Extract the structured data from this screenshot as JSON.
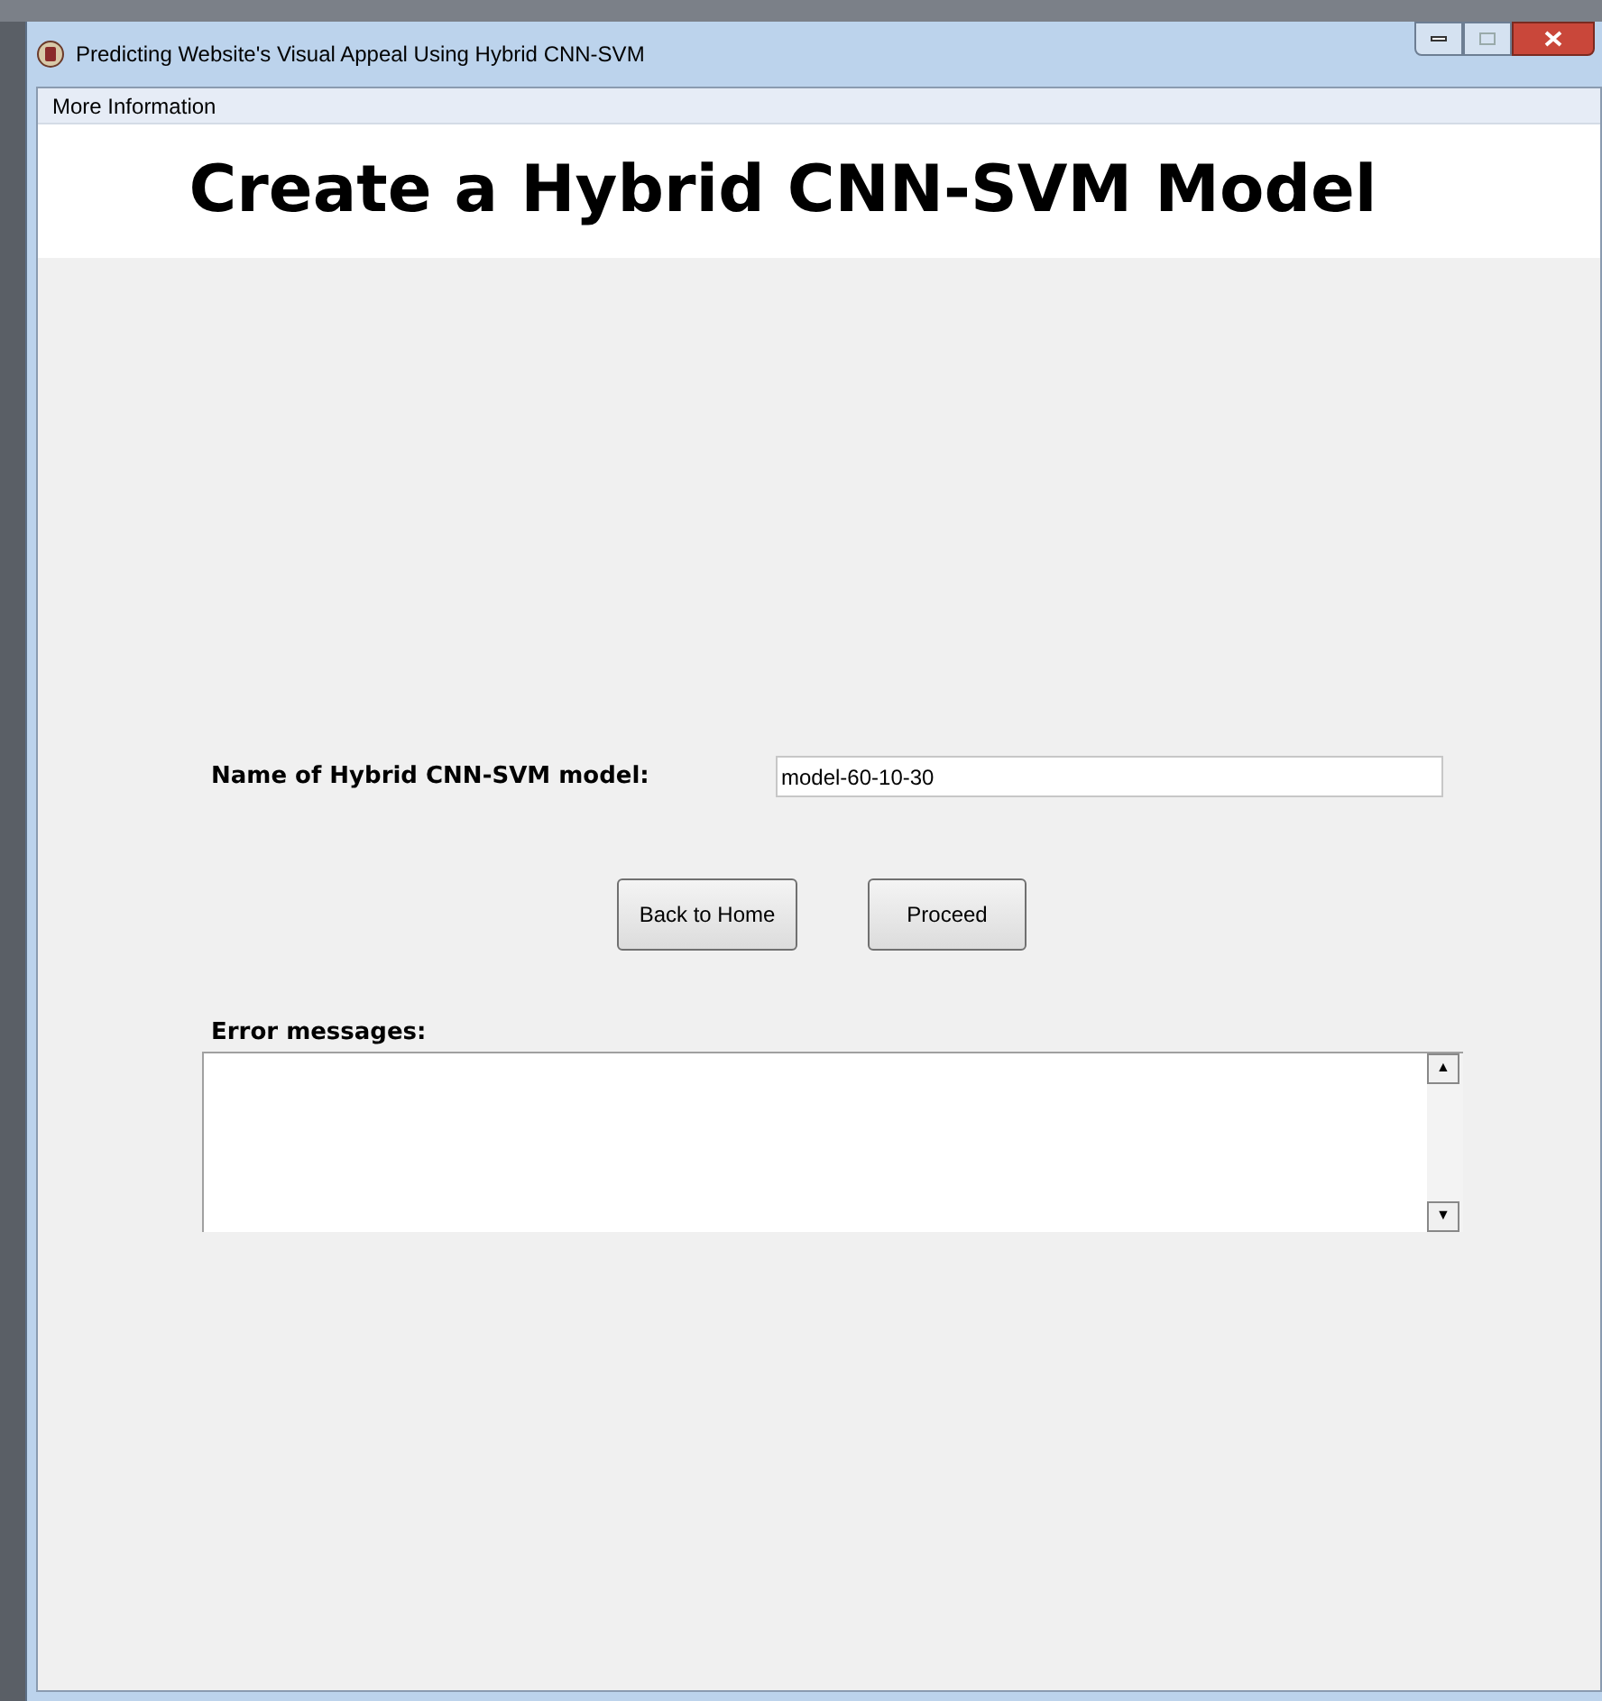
{
  "window": {
    "title": "Predicting Website's Visual Appeal Using Hybrid CNN-SVM"
  },
  "menu": [
    "More Information"
  ],
  "heading": "Create a Hybrid CNN-SVM Model",
  "name_field": {
    "label": "Name of Hybrid CNN-SVM model:",
    "value": "model-60-10-30"
  },
  "buttons": [
    "Back to Home",
    "Proceed"
  ],
  "errors": {
    "label": "Error messages:",
    "scroll_up": "▲",
    "scroll_down": "▼"
  }
}
